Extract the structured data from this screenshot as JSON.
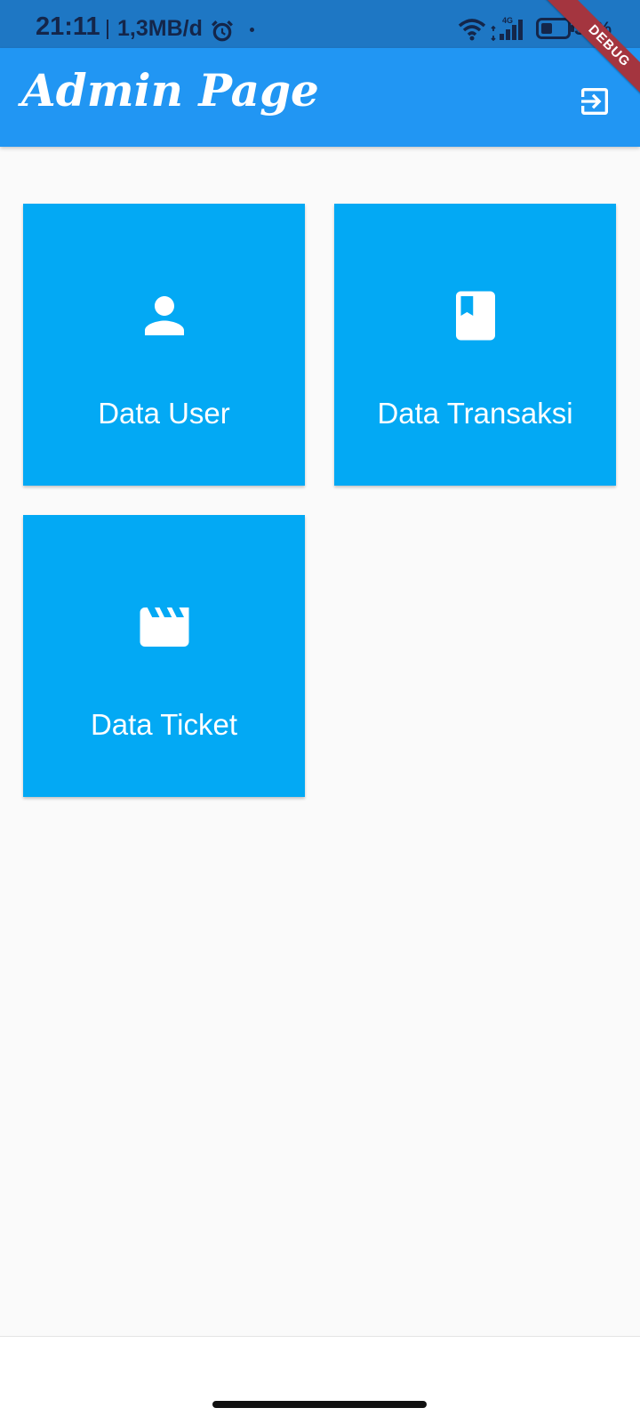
{
  "status_bar": {
    "time": "21:11",
    "net_speed": "1,3MB/d",
    "network_type": "4G",
    "battery": "34%",
    "icons": [
      "alarm-icon",
      "wifi-icon",
      "signal-icon",
      "battery-icon"
    ]
  },
  "debug_banner": "DEBUG",
  "app_bar": {
    "title": "Admin Page",
    "action_icon": "logout-icon",
    "color": "#2196f3"
  },
  "menu": {
    "tile_color": "#03a9f4",
    "items": [
      {
        "label": "Data User",
        "icon": "person-icon"
      },
      {
        "label": "Data Transaksi",
        "icon": "book-icon"
      },
      {
        "label": "Data Ticket",
        "icon": "movie-clapper-icon"
      }
    ]
  }
}
